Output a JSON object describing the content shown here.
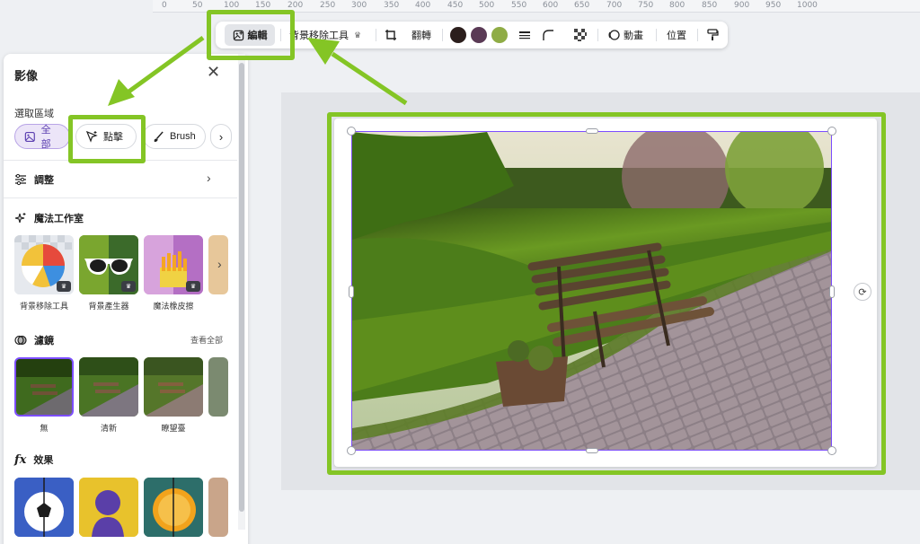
{
  "ruler": {
    "ticks": [
      "0",
      "50",
      "100",
      "150",
      "200",
      "250",
      "300",
      "350",
      "400",
      "450",
      "500",
      "550",
      "600",
      "650",
      "700",
      "750",
      "800",
      "850",
      "900",
      "950",
      "1000"
    ]
  },
  "toolbar": {
    "edit_label": "編輯",
    "bg_remover_label": "背景移除工具",
    "flip_label": "翻轉",
    "animate_label": "動畫",
    "position_label": "位置",
    "colors": [
      "#2b1e1c",
      "#5a3a55",
      "#8fac45"
    ]
  },
  "panel": {
    "title": "影像",
    "select_area_label": "選取區域",
    "chips": {
      "all": "全部",
      "click": "點擊",
      "brush": "Brush"
    },
    "adjust_label": "調整",
    "magic_studio_label": "魔法工作室",
    "magic_items": [
      "背景移除工具",
      "背景產生器",
      "魔法橡皮擦"
    ],
    "filters_label": "濾鏡",
    "see_all": "查看全部",
    "filter_items": [
      "無",
      "清新",
      "瞭望臺"
    ],
    "effects_label": "效果"
  }
}
